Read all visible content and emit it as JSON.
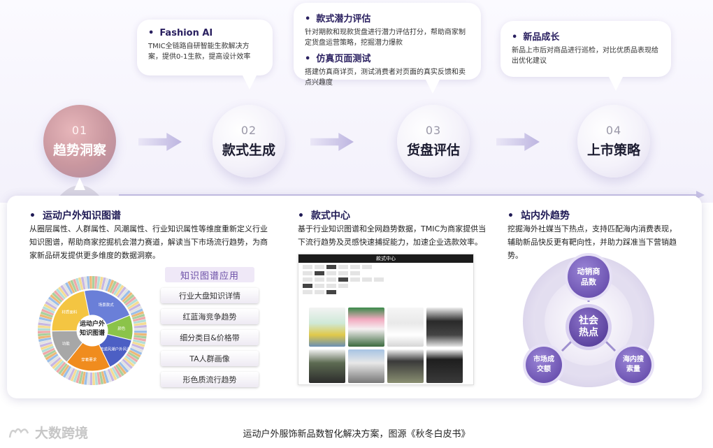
{
  "bubbles": {
    "fashion_ai": {
      "title": "Fashion AI",
      "text": "TMIC全链路自研智能生款解决方案，提供0-1生款，提高设计效率"
    },
    "potential": {
      "title": "款式潜力评估",
      "text": "针对期款和现款货盘进行潜力评估打分，帮助商家制定货盘运营策略，挖掘潜力爆款"
    },
    "simulation": {
      "title": "仿真页面测试",
      "text": "搭建仿真商详页，测试消费者对页面的真实反馈和卖点兴趣度"
    },
    "new_growth": {
      "title": "新品成长",
      "text": "新品上市后对商品进行巡检，对比优质品表现给出优化建议"
    }
  },
  "steps": [
    {
      "num": "01",
      "label": "趋势洞察"
    },
    {
      "num": "02",
      "label": "款式生成"
    },
    {
      "num": "03",
      "label": "货盘评估"
    },
    {
      "num": "04",
      "label": "上市策略"
    }
  ],
  "knowledge": {
    "title": "运动户外知识图谱",
    "text": "从圈层属性、人群属性、风潮属性、行业知识属性等维度重新定义行业知识图谱，帮助商家挖掘机会潜力赛道，解读当下市场流行趋势，为商家新品研发提供更多维度的数据洞察。",
    "center": "运动户外知识图谱",
    "segments": [
      "场景款式",
      "颜色",
      "流或风潮户外风潮",
      "穿着要求",
      "功能",
      "材质面料"
    ],
    "app_title": "知识图谱应用",
    "apps": [
      "行业大盘知识详情",
      "红蓝海竞争趋势",
      "细分类目&价格带",
      "TA人群画像",
      "形色质流行趋势"
    ]
  },
  "style_center": {
    "title": "款式中心",
    "text": "基于行业知识图谱和全网趋势数据，TMIC为商家提供当下流行趋势及灵感快速捕捉能力，加速企业选款效率。",
    "store_header": "款式中心"
  },
  "trends": {
    "title": "站内外趋势",
    "text": "挖掘海外社媒当下热点，支持匹配海内消费表现，辅助新品快反更有靶向性，并助力踩准当下营销趋势。",
    "center": "社会热点",
    "top": "动销商品数",
    "left": "市场成交额",
    "right": "海内搜索量"
  },
  "caption": "运动户外服饰新品数智化解决方案，图源《秋冬白皮书》",
  "watermark": "大数跨境",
  "colors": {
    "accent": "#6b4ea6",
    "dark": "#1f1a55",
    "donut": [
      "#6a7fd8",
      "#7bb8e8",
      "#8bc34a",
      "#4c5fc4",
      "#f08c1e",
      "#a7a7a7",
      "#f4c542"
    ]
  }
}
